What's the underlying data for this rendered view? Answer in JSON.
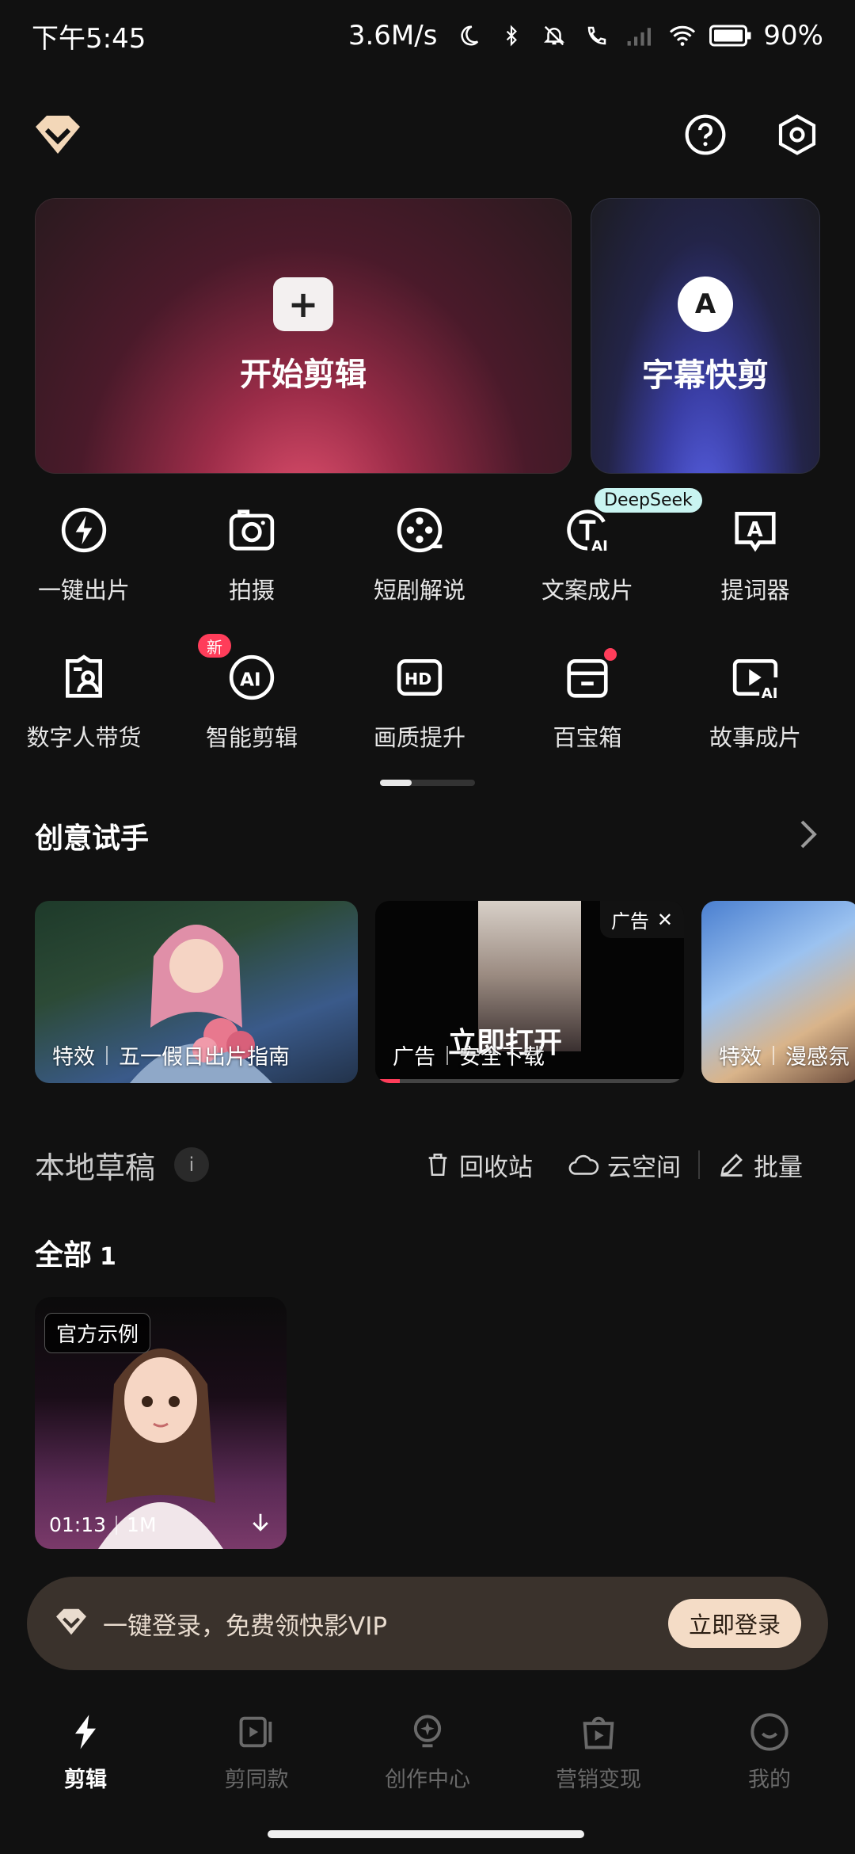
{
  "status_bar": {
    "time": "下午5:45",
    "speed": "3.6M/s",
    "battery": "90%"
  },
  "hero": {
    "main_label": "开始剪辑",
    "side_label": "字幕快剪",
    "side_icon_letter": "A"
  },
  "tools": [
    {
      "label": "一键出片",
      "icon": "lightning-circle-icon"
    },
    {
      "label": "拍摄",
      "icon": "camera-icon"
    },
    {
      "label": "短剧解说",
      "icon": "film-reel-icon"
    },
    {
      "label": "文案成片",
      "icon": "text-ai-icon",
      "badge": "DeepSeek"
    },
    {
      "label": "提词器",
      "icon": "teleprompter-icon"
    },
    {
      "label": "数字人带货",
      "icon": "digital-human-icon"
    },
    {
      "label": "智能剪辑",
      "icon": "ai-circle-icon",
      "badge": "新"
    },
    {
      "label": "画质提升",
      "icon": "hd-icon"
    },
    {
      "label": "百宝箱",
      "icon": "toolbox-icon"
    },
    {
      "label": "故事成片",
      "icon": "story-ai-icon"
    }
  ],
  "creative": {
    "title": "创意试手",
    "cards": [
      {
        "tag": "特效",
        "title": "五一假日出片指南"
      },
      {
        "tag": "广告",
        "title": "安全下载",
        "cta": "立即打开",
        "ad_label": "广告",
        "close": "✕"
      },
      {
        "tag": "特效",
        "title": "漫感氛"
      }
    ]
  },
  "drafts": {
    "title": "本地草稿",
    "info": "i",
    "recycle": "回收站",
    "cloud": "云空间",
    "batch": "批量",
    "all_label": "全部",
    "count": "1",
    "item": {
      "tag": "官方示例",
      "duration": "01:13",
      "size": "1M"
    }
  },
  "login_banner": {
    "text": "一键登录，免费领快影VIP",
    "button": "立即登录"
  },
  "nav": [
    {
      "label": "剪辑",
      "active": true
    },
    {
      "label": "剪同款",
      "active": false
    },
    {
      "label": "创作中心",
      "active": false
    },
    {
      "label": "营销变现",
      "active": false
    },
    {
      "label": "我的",
      "active": false
    }
  ],
  "colors": {
    "background": "#111111",
    "accent_red": "#ff3d5a",
    "login_button": "#f4dcc6",
    "logo": "#f3d7b8"
  }
}
